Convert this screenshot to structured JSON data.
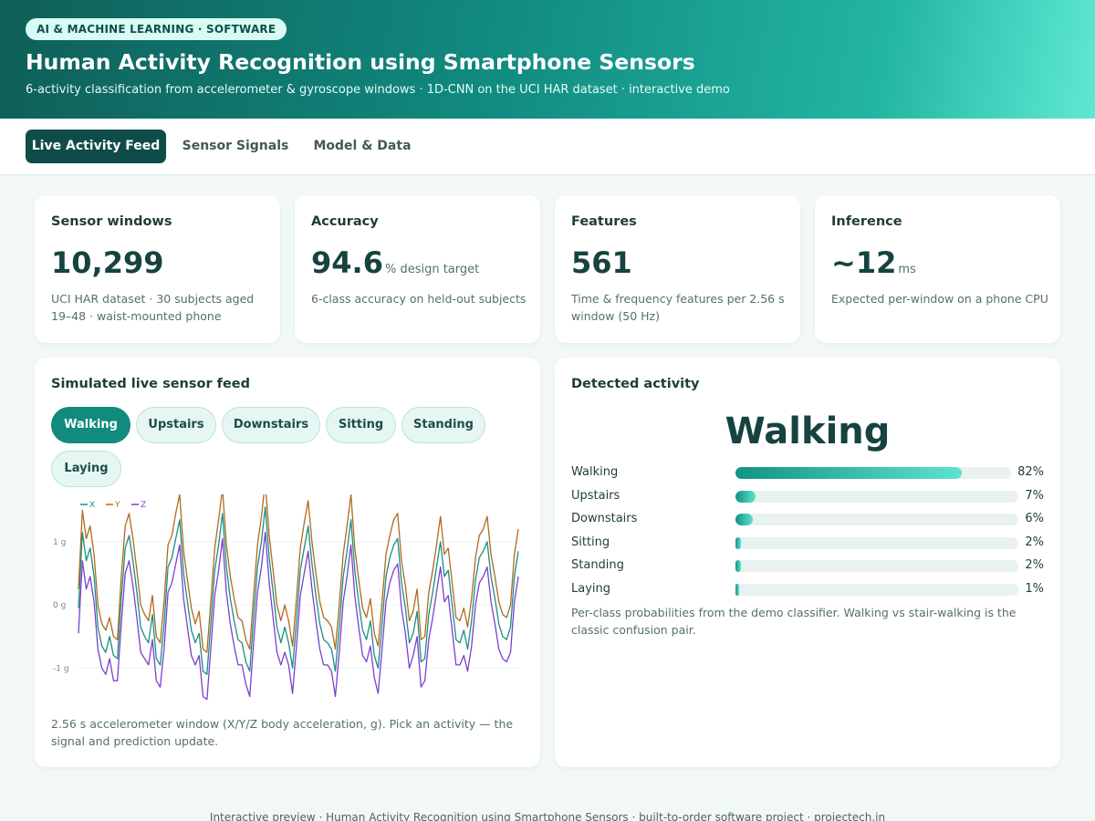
{
  "hero": {
    "tag": "AI & MACHINE LEARNING · SOFTWARE",
    "title": "Human Activity Recognition using Smartphone Sensors",
    "subtitle": "6-activity classification from accelerometer & gyroscope windows · 1D-CNN on the UCI HAR dataset · interactive demo"
  },
  "tabs": [
    {
      "label": "Live Activity Feed",
      "active": true
    },
    {
      "label": "Sensor Signals",
      "active": false
    },
    {
      "label": "Model & Data",
      "active": false
    }
  ],
  "stats": [
    {
      "label": "Sensor windows",
      "value": "10,299",
      "unit": "",
      "desc": "UCI HAR dataset · 30 subjects aged 19–48 · waist-mounted phone"
    },
    {
      "label": "Accuracy",
      "value": "94.6",
      "unit": "% design target",
      "desc": "6-class accuracy on held-out subjects"
    },
    {
      "label": "Features",
      "value": "561",
      "unit": "",
      "desc": "Time & frequency features per 2.56 s window (50 Hz)"
    },
    {
      "label": "Inference",
      "value": "~12",
      "unit": "ms",
      "desc": "Expected per-window on a phone CPU"
    }
  ],
  "feed": {
    "title": "Simulated live sensor feed",
    "activities": [
      {
        "label": "Walking",
        "active": true
      },
      {
        "label": "Upstairs",
        "active": false
      },
      {
        "label": "Downstairs",
        "active": false
      },
      {
        "label": "Sitting",
        "active": false
      },
      {
        "label": "Standing",
        "active": false
      },
      {
        "label": "Laying",
        "active": false
      }
    ],
    "caption": "2.56 s accelerometer window (X/Y/Z body acceleration, g). Pick an activity — the signal and prediction update."
  },
  "chart_data": {
    "type": "line",
    "title": "",
    "xlabel": "",
    "ylabel": "",
    "y_ticks": [
      "1 g",
      "0 g",
      "-1 g"
    ],
    "ylim": [
      -1.5,
      1.75
    ],
    "grid": true,
    "legend_position": "top-left",
    "series": [
      {
        "name": "X",
        "color": "#1a8f82",
        "values": [
          -0.05,
          1.15,
          0.7,
          0.9,
          0.45,
          -0.35,
          -0.65,
          -0.75,
          -0.5,
          -0.8,
          -0.85,
          0.1,
          0.9,
          1.1,
          0.7,
          0.2,
          -0.35,
          -0.5,
          -0.6,
          -0.15,
          -0.85,
          -0.95,
          -0.3,
          0.6,
          0.75,
          1.05,
          1.35,
          0.5,
          0.05,
          -0.4,
          -0.6,
          -0.45,
          -1.05,
          -1.1,
          -0.3,
          0.55,
          0.95,
          1.45,
          0.6,
          0.1,
          -0.25,
          -0.55,
          -0.6,
          -0.9,
          -1.05,
          -0.2,
          0.6,
          1.0,
          1.55,
          0.75,
          0.2,
          -0.35,
          -0.6,
          -0.35,
          -0.6,
          -1.0,
          -0.25,
          0.55,
          0.9,
          1.25,
          0.65,
          0.15,
          -0.3,
          -0.55,
          -0.6,
          -0.7,
          -1.05,
          -0.35,
          0.45,
          0.85,
          1.35,
          0.55,
          0.05,
          -0.4,
          -0.55,
          -0.25,
          -0.8,
          -1.0,
          -0.3,
          0.45,
          0.75,
          0.95,
          1.05,
          0.35,
          -0.05,
          -0.6,
          -0.45,
          -0.1,
          -0.9,
          -0.85,
          -0.15,
          0.2,
          0.6,
          1.0,
          0.45,
          0.55,
          0.0,
          -0.55,
          -0.6,
          -0.4,
          -0.7,
          -0.25,
          0.4,
          0.75,
          0.85,
          1.0,
          0.45,
          0.1,
          -0.3,
          -0.5,
          -0.55,
          -0.35,
          0.45,
          0.85
        ]
      },
      {
        "name": "Y",
        "color": "#b06a1e",
        "values": [
          0.25,
          1.5,
          1.05,
          1.25,
          0.8,
          0.0,
          -0.3,
          -0.4,
          -0.2,
          -0.5,
          -0.55,
          0.45,
          1.25,
          1.45,
          1.05,
          0.55,
          0.0,
          -0.15,
          -0.25,
          0.15,
          -0.5,
          -0.6,
          0.05,
          0.95,
          1.1,
          1.45,
          1.75,
          0.85,
          0.4,
          -0.05,
          -0.3,
          -0.1,
          -0.7,
          -0.75,
          0.05,
          0.9,
          1.35,
          1.85,
          0.95,
          0.45,
          0.1,
          -0.2,
          -0.25,
          -0.55,
          -0.7,
          0.15,
          0.95,
          1.4,
          1.95,
          1.1,
          0.55,
          0.0,
          -0.25,
          0.0,
          -0.25,
          -0.65,
          0.1,
          0.9,
          1.3,
          1.65,
          1.0,
          0.5,
          0.05,
          -0.2,
          -0.25,
          -0.35,
          -0.7,
          0.0,
          0.8,
          1.25,
          1.75,
          0.9,
          0.4,
          -0.05,
          -0.2,
          0.1,
          -0.45,
          -0.65,
          0.05,
          0.8,
          1.1,
          1.35,
          1.45,
          0.7,
          0.3,
          -0.25,
          -0.1,
          0.25,
          -0.55,
          -0.5,
          0.2,
          0.55,
          0.95,
          1.4,
          0.8,
          0.9,
          0.35,
          -0.2,
          -0.25,
          -0.05,
          -0.35,
          0.1,
          0.75,
          1.1,
          1.2,
          1.4,
          0.8,
          0.45,
          0.05,
          -0.15,
          -0.2,
          0.0,
          0.8,
          1.2
        ]
      },
      {
        "name": "Z",
        "color": "#7b3fd0",
        "values": [
          -0.45,
          0.7,
          0.25,
          0.45,
          0.05,
          -0.7,
          -1.0,
          -1.1,
          -0.85,
          -1.2,
          -1.2,
          -0.3,
          0.5,
          0.7,
          0.3,
          -0.2,
          -0.75,
          -0.85,
          -0.95,
          -0.55,
          -1.2,
          -1.3,
          -0.7,
          0.2,
          0.35,
          0.65,
          0.95,
          0.1,
          -0.35,
          -0.8,
          -0.95,
          -0.8,
          -1.45,
          -1.5,
          -0.7,
          0.15,
          0.55,
          1.05,
          0.2,
          -0.3,
          -0.65,
          -0.95,
          -0.95,
          -1.25,
          -1.45,
          -0.6,
          0.2,
          0.6,
          1.15,
          0.35,
          -0.2,
          -0.75,
          -0.95,
          -0.75,
          -0.95,
          -1.4,
          -0.65,
          0.15,
          0.5,
          0.85,
          0.25,
          -0.25,
          -0.7,
          -0.95,
          -0.95,
          -1.05,
          -1.45,
          -0.75,
          0.05,
          0.45,
          0.95,
          0.15,
          -0.35,
          -0.8,
          -0.9,
          -0.65,
          -1.15,
          -1.4,
          -0.7,
          0.05,
          0.35,
          0.55,
          0.65,
          -0.05,
          -0.45,
          -1.0,
          -0.8,
          -0.5,
          -1.3,
          -1.2,
          -0.55,
          -0.2,
          0.2,
          0.6,
          0.05,
          0.15,
          -0.4,
          -0.95,
          -0.95,
          -0.8,
          -1.05,
          -0.65,
          0.0,
          0.35,
          0.45,
          0.6,
          0.05,
          -0.3,
          -0.7,
          -0.85,
          -0.9,
          -0.75,
          0.05,
          0.45
        ]
      }
    ]
  },
  "detected": {
    "title": "Detected activity",
    "activity": "Walking",
    "probs": [
      {
        "name": "Walking",
        "pct": "82%",
        "value": 0.82
      },
      {
        "name": "Upstairs",
        "pct": "7%",
        "value": 0.07
      },
      {
        "name": "Downstairs",
        "pct": "6%",
        "value": 0.06
      },
      {
        "name": "Sitting",
        "pct": "2%",
        "value": 0.02
      },
      {
        "name": "Standing",
        "pct": "2%",
        "value": 0.02
      },
      {
        "name": "Laying",
        "pct": "1%",
        "value": 0.01
      }
    ],
    "caption": "Per-class probabilities from the demo classifier. Walking vs stair-walking is the classic confusion pair."
  },
  "footer": "Interactive preview · Human Activity Recognition using Smartphone Sensors · built-to-order software project · projectech.in"
}
